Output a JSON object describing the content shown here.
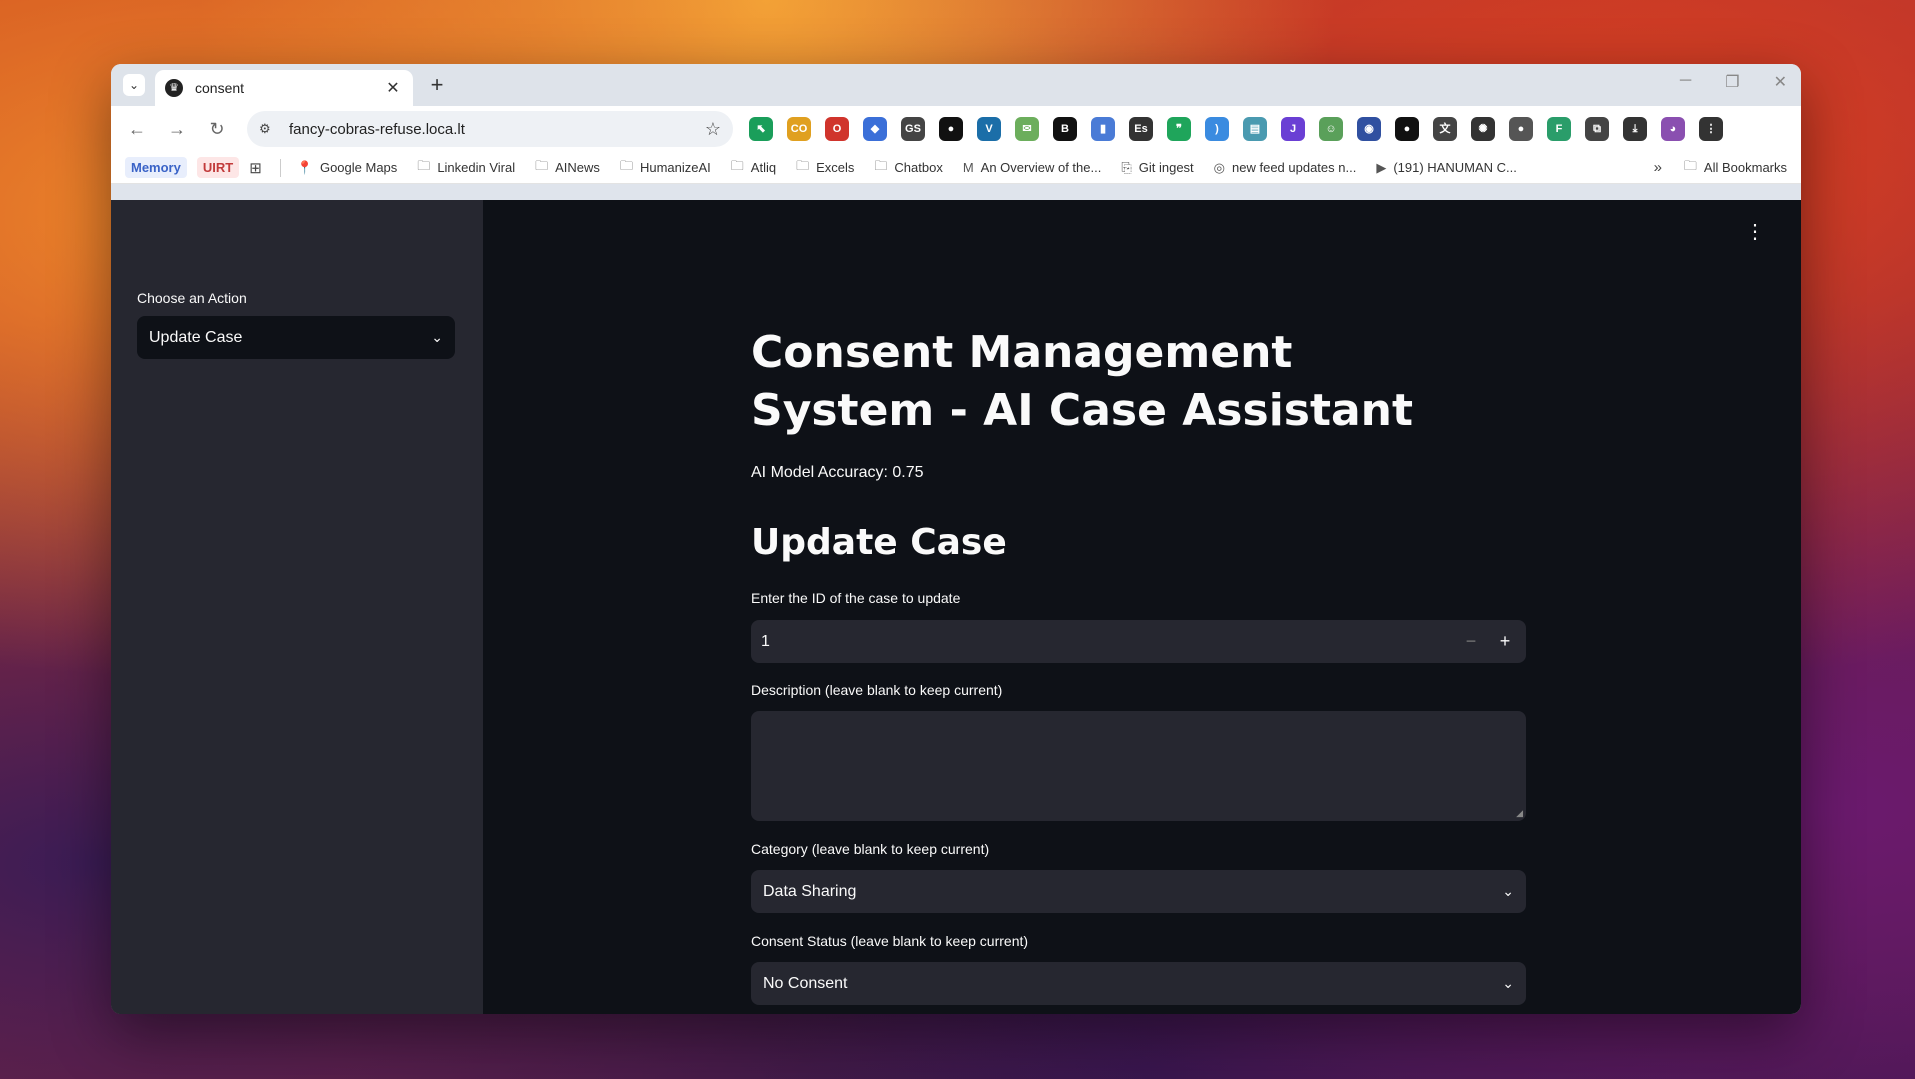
{
  "browser": {
    "tab_title": "consent",
    "tab_favicon": "♛",
    "url": "fancy-cobras-refuse.loca.lt",
    "extensions": [
      {
        "name": "cursor-ext-icon",
        "glyph": "⬉",
        "color": "#1a9e5a"
      },
      {
        "name": "cc-ext-icon",
        "glyph": "CO",
        "color": "#e0a020"
      },
      {
        "name": "opera-ext-icon",
        "glyph": "O",
        "color": "#d0342c"
      },
      {
        "name": "graduation-ext-icon",
        "glyph": "◆",
        "color": "#3b6fd8"
      },
      {
        "name": "gs-ext-icon",
        "glyph": "GS",
        "color": "#444444"
      },
      {
        "name": "github-ext-icon",
        "glyph": "●",
        "color": "#111111"
      },
      {
        "name": "v-ext-icon",
        "glyph": "V",
        "color": "#1b6ea8"
      },
      {
        "name": "inbox-ext-icon",
        "glyph": "✉",
        "color": "#6cae5c"
      },
      {
        "name": "b-ext-icon",
        "glyph": "B",
        "color": "#111111"
      },
      {
        "name": "bars-ext-icon",
        "glyph": "▮",
        "color": "#4a7bd6"
      },
      {
        "name": "es-ext-icon",
        "glyph": "Es",
        "color": "#333333"
      },
      {
        "name": "quote-ext-icon",
        "glyph": "❞",
        "color": "#1fa55b"
      },
      {
        "name": "sound-ext-icon",
        "glyph": ")",
        "color": "#3a8be0"
      },
      {
        "name": "printer-ext-icon",
        "glyph": "▤",
        "color": "#4a9ab0"
      },
      {
        "name": "j-ext-icon",
        "glyph": "J",
        "color": "#6a3fd4"
      },
      {
        "name": "robot-ext-icon",
        "glyph": "☺",
        "color": "#5aa05a"
      },
      {
        "name": "face-ext-icon",
        "glyph": "◉",
        "color": "#3050a0"
      },
      {
        "name": "github2-ext-icon",
        "glyph": "●",
        "color": "#111111"
      },
      {
        "name": "translate-ext-icon",
        "glyph": "文",
        "color": "#444444"
      },
      {
        "name": "aperture-ext-icon",
        "glyph": "✺",
        "color": "#333333"
      },
      {
        "name": "circle-ext-icon",
        "glyph": "●",
        "color": "#555555"
      },
      {
        "name": "f-ext-icon",
        "glyph": "F",
        "color": "#2a9d6a"
      },
      {
        "name": "puzzle-ext-icon",
        "glyph": "⧉",
        "color": "#444444"
      },
      {
        "name": "download-icon",
        "glyph": "⤓",
        "color": "#333333"
      },
      {
        "name": "profile-avatar-icon",
        "glyph": "◕",
        "color": "#8a4fb0"
      },
      {
        "name": "browser-menu-icon",
        "glyph": "⋮",
        "color": "#333333"
      }
    ],
    "bookmarks": {
      "memory": "Memory",
      "uirt": "UIRT",
      "items": [
        {
          "icon": "map-pin-icon",
          "glyph": "📍",
          "label": "Google Maps"
        },
        {
          "icon": "folder-icon",
          "glyph": "🗀",
          "label": "Linkedin Viral"
        },
        {
          "icon": "folder-icon",
          "glyph": "🗀",
          "label": "AINews"
        },
        {
          "icon": "folder-icon",
          "glyph": "🗀",
          "label": "HumanizeAI"
        },
        {
          "icon": "folder-icon",
          "glyph": "🗀",
          "label": "Atliq"
        },
        {
          "icon": "folder-icon",
          "glyph": "🗀",
          "label": "Excels"
        },
        {
          "icon": "folder-icon",
          "glyph": "🗀",
          "label": "Chatbox"
        },
        {
          "icon": "medium-icon",
          "glyph": "M",
          "label": "An Overview of the..."
        },
        {
          "icon": "git-ingest-icon",
          "glyph": "⎘",
          "label": "Git ingest"
        },
        {
          "icon": "globe-icon",
          "glyph": "◎",
          "label": "new feed updates n..."
        },
        {
          "icon": "youtube-icon",
          "glyph": "▶",
          "label": "(191) HANUMAN C..."
        }
      ],
      "all_bookmarks": "All Bookmarks"
    }
  },
  "sidebar": {
    "label": "Choose an Action",
    "selected": "Update Case"
  },
  "main": {
    "title": "Consent Management System - AI Case Assistant",
    "accuracy": "AI Model Accuracy: 0.75",
    "section": "Update Case",
    "id_label": "Enter the ID of the case to update",
    "id_value": "1",
    "description_label": "Description (leave blank to keep current)",
    "description_value": "",
    "category_label": "Category (leave blank to keep current)",
    "category_value": "Data Sharing",
    "status_label": "Consent Status (leave blank to keep current)",
    "status_value": "No Consent"
  }
}
